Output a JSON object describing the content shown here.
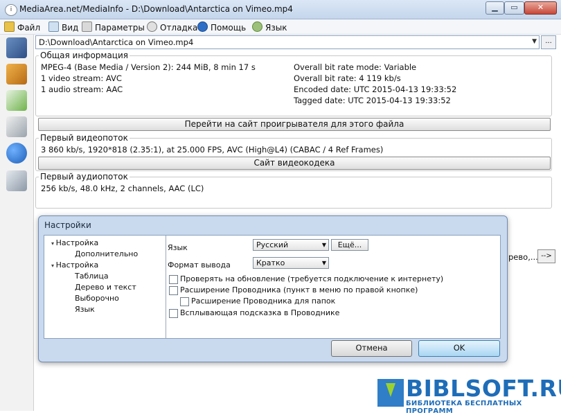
{
  "window": {
    "title": "MediaArea.net/MediaInfo - D:\\Download\\Antarctica on Vimeo.mp4",
    "min_label": "▁",
    "max_label": "▭",
    "close_label": "✕"
  },
  "menu": [
    {
      "label": "Файл",
      "icon": "folder-icon"
    },
    {
      "label": "Вид",
      "icon": "view-icon"
    },
    {
      "label": "Параметры",
      "icon": "options-icon"
    },
    {
      "label": "Отладка",
      "icon": "debug-icon"
    },
    {
      "label": "Помощь",
      "icon": "help-icon"
    },
    {
      "label": "Язык",
      "icon": "language-icon"
    }
  ],
  "file_path": "D:\\Download\\Antarctica on Vimeo.mp4",
  "browse_label": "...",
  "general": {
    "title": "Общая информация",
    "left": [
      "MPEG-4 (Base Media / Version 2): 244 MiB, 8 min 17 s",
      "1 video stream: AVC",
      "1 audio stream: AAC"
    ],
    "right": [
      "Overall bit rate mode: Variable",
      "Overall bit rate: 4 119 kb/s",
      "Encoded date: UTC 2015-04-13 19:33:52",
      "Tagged date: UTC 2015-04-13 19:33:52"
    ],
    "button": "Перейти на сайт проигрывателя для этого файла"
  },
  "video": {
    "title": "Первый видеопоток",
    "line": "3 860 kb/s, 1920*818 (2.35:1), at 25.000 FPS, AVC (High@L4) (CABAC / 4 Ref Frames)",
    "button": "Сайт видеокодека"
  },
  "audio": {
    "title": "Первый аудиопоток",
    "line": "256 kb/s, 48.0 kHz, 2 channels, AAC (LC)"
  },
  "behind": {
    "text": "рево,...)",
    "arrow_label": "-->"
  },
  "dialog": {
    "title": "Настройки",
    "tree": [
      "Настройка",
      "Дополнительно",
      "Настройка",
      "Таблица",
      "Дерево и текст",
      "Выборочно",
      "Язык"
    ],
    "language_label": "Язык",
    "language_value": "Русский",
    "more_button": "Ещё...",
    "format_label": "Формат вывода",
    "format_value": "Кратко",
    "options": [
      "Проверять на обновление (требуется подключение к интернету)",
      "Расширение Проводника (пункт в меню по правой кнопке)",
      "Расширение Проводника для папок",
      "Всплывающая подсказка в Проводнике"
    ],
    "cancel": "Отмена",
    "ok": "OK"
  },
  "watermark": {
    "title": "BIBLSOFT.RU",
    "subtitle": "БИБЛИОТЕКА БЕСПЛАТНЫХ ПРОГРАММ"
  }
}
